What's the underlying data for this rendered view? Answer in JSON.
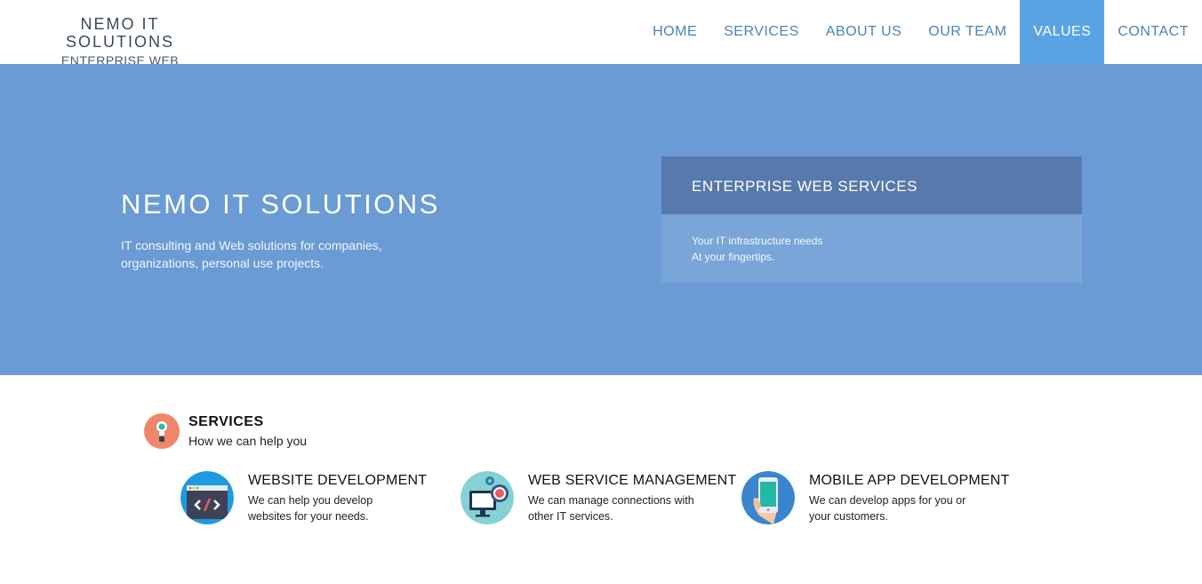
{
  "header": {
    "brand_title": "NEMO IT SOLUTIONS",
    "brand_subtitle": "ENTERPRISE WEB SERVICES",
    "nav": [
      {
        "label": "HOME"
      },
      {
        "label": "SERVICES"
      },
      {
        "label": "ABOUT US"
      },
      {
        "label": "OUR TEAM"
      },
      {
        "label": "VALUES",
        "active": true
      },
      {
        "label": "CONTACT"
      }
    ]
  },
  "hero": {
    "title": "NEMO IT SOLUTIONS",
    "description_line1": "IT consulting and Web solutions for companies,",
    "description_line2": "organizations, personal use projects.",
    "panel": {
      "heading": "ENTERPRISE WEB SERVICES",
      "line1": "Your IT infrastructure needs",
      "line2": "At your fingertips."
    }
  },
  "services": {
    "title": "SERVICES",
    "subtitle": "How we can help you",
    "items": [
      {
        "title": "WEBSITE DEVELOPMENT",
        "line1": "We can help you develop",
        "line2": "websites for your needs.",
        "icon": "code-monitor-icon"
      },
      {
        "title": "WEB SERVICE MANAGEMENT",
        "line1": "We can manage connections with",
        "line2": "other IT services.",
        "icon": "computer-gear-icon"
      },
      {
        "title": "MOBILE APP DEVELOPMENT",
        "line1": "We can develop apps for you or",
        "line2": "your customers.",
        "icon": "phone-hand-icon"
      }
    ]
  },
  "colors": {
    "hero_bg": "#6a9bd4",
    "nav_active": "#5aa3e3",
    "panel_head": "#5779ab",
    "panel_body": "#7aa5d8",
    "nav_text": "#4d82ba"
  }
}
